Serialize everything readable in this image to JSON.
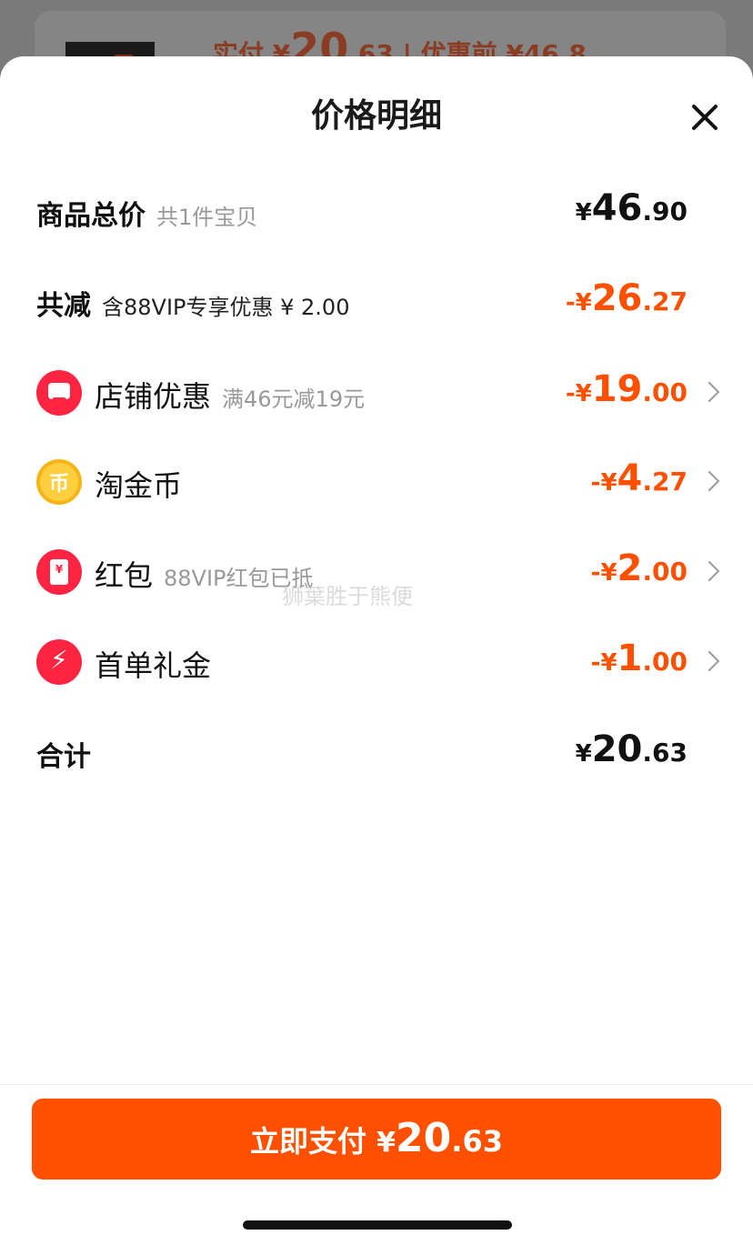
{
  "background": {
    "price_prefix": "实付 ¥",
    "price_int": "20",
    "price_dec": ".63",
    "separator": "|",
    "original": "优惠前 ¥46.8"
  },
  "sheet": {
    "title": "价格明细"
  },
  "rows": {
    "total": {
      "label": "商品总价",
      "sub": "共1件宝贝",
      "currency": "¥",
      "int": "46",
      "dec": ".90"
    },
    "reduce": {
      "label": "共减",
      "sub": "含88VIP专享优惠 ¥ 2.00",
      "currency": "-¥",
      "int": "26",
      "dec": ".27"
    },
    "store": {
      "label": "店铺优惠",
      "sub": "满46元减19元",
      "currency": "-¥",
      "int": "19",
      "dec": ".00"
    },
    "coin": {
      "label": "淘金币",
      "icon_glyph": "币",
      "currency": "-¥",
      "int": "4",
      "dec": ".27"
    },
    "redpacket": {
      "label": "红包",
      "sub": "88VIP红包已抵",
      "icon_glyph": "¥",
      "currency": "-¥",
      "int": "2",
      "dec": ".00"
    },
    "firstorder": {
      "label": "首单礼金",
      "currency": "-¥",
      "int": "1",
      "dec": ".00"
    },
    "sum": {
      "label": "合计",
      "currency": "¥",
      "int": "20",
      "dec": ".63"
    }
  },
  "watermark": "狮葉胜于熊便",
  "pay_button": {
    "label": "立即支付 ",
    "currency": "¥",
    "int": "20",
    "dec": ".63"
  },
  "colors": {
    "accent": "#ff5000",
    "red": "#ff2442",
    "coin": "#ffcf3f"
  }
}
